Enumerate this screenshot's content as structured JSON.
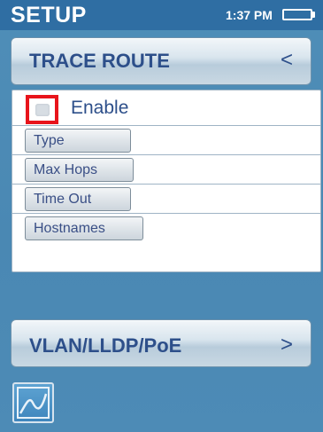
{
  "status": {
    "title": "SETUP",
    "time": "1:37 PM"
  },
  "trace_route": {
    "title": "TRACE ROUTE",
    "chevron": "<",
    "enable_label": "Enable",
    "enable_checked": false,
    "options": [
      "Type",
      "Max Hops",
      "Time Out",
      "Hostnames"
    ]
  },
  "vlan": {
    "title": "VLAN/LLDP/PoE",
    "chevron": ">"
  },
  "icons": {
    "battery": "battery-icon",
    "graph": "graph-icon"
  }
}
